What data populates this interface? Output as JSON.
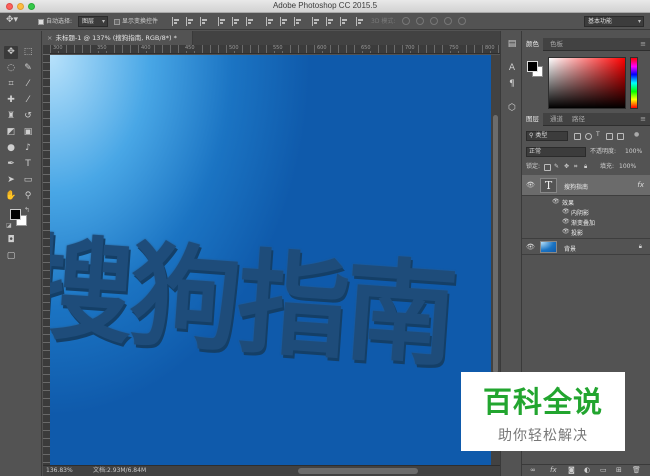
{
  "window": {
    "title": "Adobe Photoshop CC 2015.5"
  },
  "options_bar": {
    "auto_select_label": "自动选择:",
    "auto_select_value": "图层",
    "show_transform_label": "显示变换控件",
    "mode_3d_label": "3D 模式:",
    "workspace_value": "基本功能"
  },
  "document": {
    "tab_title": "未标题-1 @ 137% (搜狗指南, RGB/8*) *",
    "canvas_text": "搜狗指南",
    "ruler_numbers": [
      "300",
      "350",
      "400",
      "450",
      "500",
      "550",
      "600",
      "650",
      "700",
      "750",
      "800"
    ]
  },
  "status_bar": {
    "zoom": "136.83%",
    "doc_info": "文档:2.93M/6.84M"
  },
  "color_panel": {
    "tabs": [
      "颜色",
      "色板"
    ],
    "foreground": "#000000",
    "background": "#ffffff"
  },
  "layers_panel": {
    "tabs": [
      "图层",
      "通道",
      "路径"
    ],
    "filter_kind": "类型",
    "blend_mode": "正常",
    "opacity_label": "不透明度:",
    "opacity_value": "100%",
    "lock_label": "锁定:",
    "fill_label": "填充:",
    "fill_value": "100%",
    "layers": [
      {
        "name": "搜狗指南",
        "type": "text",
        "fx": "fx"
      },
      {
        "name": "背景",
        "type": "background"
      }
    ],
    "effects_label": "效果",
    "effects": [
      "内阴影",
      "渐变叠加",
      "投影"
    ]
  },
  "watermark": {
    "title": "百科全说",
    "subtitle": "助你轻松解决"
  },
  "colors": {
    "accent_green": "#22a52f",
    "canvas_dark": "#0f5aab",
    "canvas_light": "#b8e2fb"
  }
}
